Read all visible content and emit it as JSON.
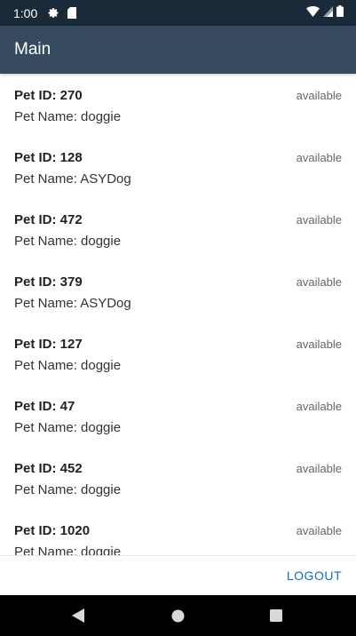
{
  "status_bar": {
    "time": "1:00",
    "icons": [
      "settings-icon",
      "sd-card-icon",
      "wifi-icon",
      "signal-icon",
      "battery-icon"
    ]
  },
  "app_bar": {
    "title": "Main"
  },
  "pets": [
    {
      "id_label": "Pet ID: 270",
      "name_label": "Pet Name: doggie",
      "status": "available"
    },
    {
      "id_label": "Pet ID: 128",
      "name_label": "Pet Name: ASYDog",
      "status": "available"
    },
    {
      "id_label": "Pet ID: 472",
      "name_label": "Pet Name: doggie",
      "status": "available"
    },
    {
      "id_label": "Pet ID: 379",
      "name_label": "Pet Name: ASYDog",
      "status": "available"
    },
    {
      "id_label": "Pet ID: 127",
      "name_label": "Pet Name: doggie",
      "status": "available"
    },
    {
      "id_label": "Pet ID: 47",
      "name_label": "Pet Name: doggie",
      "status": "available"
    },
    {
      "id_label": "Pet ID: 452",
      "name_label": "Pet Name: doggie",
      "status": "available"
    },
    {
      "id_label": "Pet ID: 1020",
      "name_label": "Pet Name: doggie",
      "status": "available"
    }
  ],
  "footer": {
    "logout_label": "LOGOUT"
  },
  "nav_bar": {
    "icons": [
      "back-icon",
      "home-icon",
      "recents-icon"
    ]
  },
  "colors": {
    "status_bar": "#1b2a38",
    "app_bar": "#354a5f",
    "accent": "#0a6ed1"
  }
}
